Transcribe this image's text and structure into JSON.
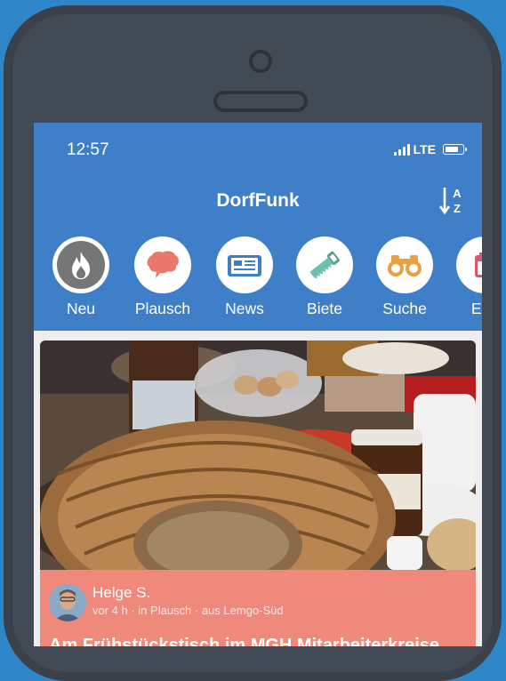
{
  "status_bar": {
    "time": "12:57",
    "network": "LTE"
  },
  "header": {
    "title": "DorfFunk",
    "sort_icon": "sort-alpha-icon"
  },
  "categories": [
    {
      "label": "Neu",
      "icon": "flame-icon"
    },
    {
      "label": "Plausch",
      "icon": "speech-bubble-icon"
    },
    {
      "label": "News",
      "icon": "newspaper-icon"
    },
    {
      "label": "Biete",
      "icon": "saw-icon"
    },
    {
      "label": "Suche",
      "icon": "binoculars-icon"
    },
    {
      "label": "Eve",
      "icon": "calendar-icon"
    }
  ],
  "post": {
    "author": "Helge S.",
    "meta": "vor 4 h · in Plausch · aus Lemgo-Süd",
    "title": "Am Frühstückstisch im MGH Mitarbeiterkreise",
    "image": "breakfast-table-photo"
  },
  "colors": {
    "background": "#2e86c9",
    "phone": "#424a55",
    "header": "#3f7fc7",
    "post_info": "#ef897c"
  }
}
